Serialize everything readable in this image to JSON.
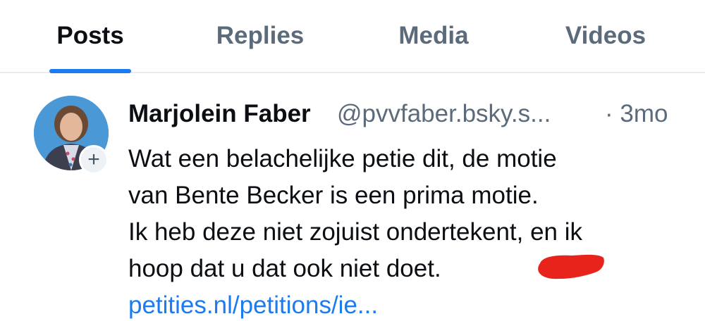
{
  "tabs": [
    {
      "label": "Posts",
      "active": true
    },
    {
      "label": "Replies",
      "active": false
    },
    {
      "label": "Media",
      "active": false
    },
    {
      "label": "Videos",
      "active": false
    }
  ],
  "post": {
    "author_name": "Marjolein Faber",
    "author_handle": "@pvvfaber.bsky.s...",
    "time": "· 3mo",
    "follow_symbol": "+",
    "text_lines": [
      "Wat een belachelijke petie dit, de motie",
      "van Bente Becker is een prima motie.",
      "Ik heb deze niet zojuist ondertekent, en ik",
      "hoop dat u dat ook niet doet."
    ],
    "link_text": "petities.nl/petitions/ie..."
  },
  "colors": {
    "accent": "#1d7bf0",
    "muted_text": "#5b6b7b",
    "redaction": "#e8231c"
  },
  "icons": {
    "avatar": "profile-photo",
    "follow": "plus-icon"
  }
}
